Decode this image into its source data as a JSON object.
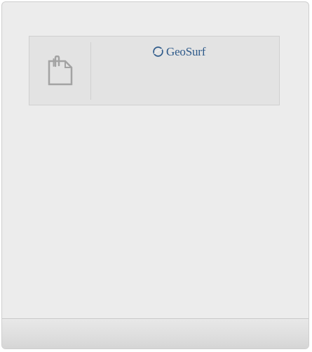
{
  "brand": {
    "name": "GeoSurf",
    "color": "#2e5a8a"
  },
  "icons": {
    "card_icon": "clipboard-icon",
    "brand_icon": "geosurf-logo-icon"
  }
}
